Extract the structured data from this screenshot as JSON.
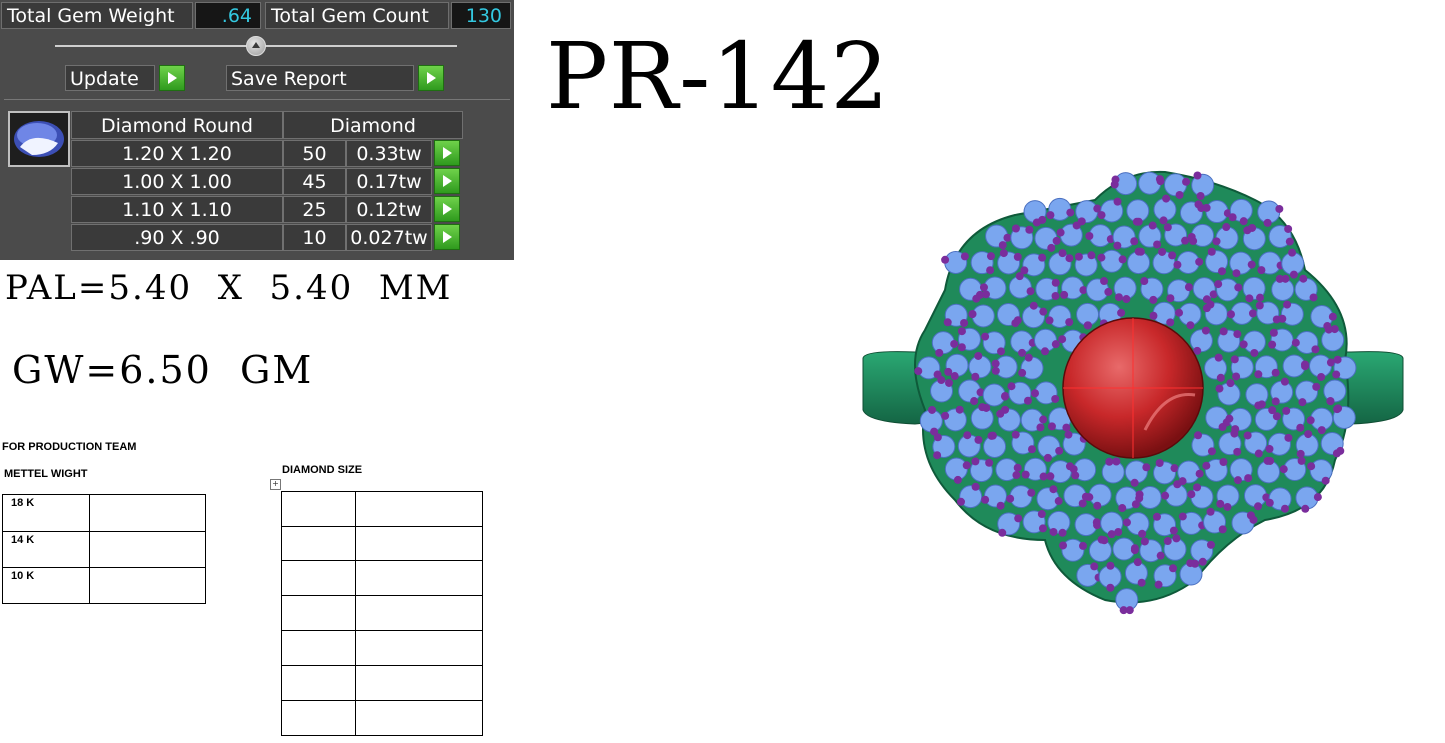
{
  "gem_panel": {
    "total_weight_label": "Total Gem Weight",
    "total_weight_value": ".64",
    "total_count_label": "Total Gem Count",
    "total_count_value": "130",
    "update_label": "Update",
    "save_report_label": "Save Report",
    "header_shape": "Diamond Round",
    "header_material": "Diamond",
    "rows": [
      {
        "size": "1.20 X 1.20",
        "count": "50",
        "weight": "0.33tw"
      },
      {
        "size": "1.00 X 1.00",
        "count": "45",
        "weight": "0.17tw"
      },
      {
        "size": "1.10 X 1.10",
        "count": "25",
        "weight": "0.12tw"
      },
      {
        "size": ".90 X .90",
        "count": "10",
        "weight": "0.027tw"
      }
    ]
  },
  "title": "PR-142",
  "specs": {
    "pal": "PAL=5.40  X  5.40  MM",
    "gw": "GW=6.50  GM"
  },
  "production": {
    "heading": "FOR PRODUCTION TEAM",
    "metal_heading": "METTEL WIGHT",
    "diamond_heading": "DIAMOND SIZE",
    "metal_rows": [
      "18 K",
      "14 K",
      "10 K"
    ]
  },
  "colors": {
    "panel_bg": "#4b4b4b",
    "value_text": "#33c8e0",
    "play_green": "#3fae2a",
    "ring_metal": "#1f8a5a",
    "stone_blue": "#7aa6ef",
    "prong_purple": "#7a2d9c",
    "center_stone": "#c8282a"
  }
}
